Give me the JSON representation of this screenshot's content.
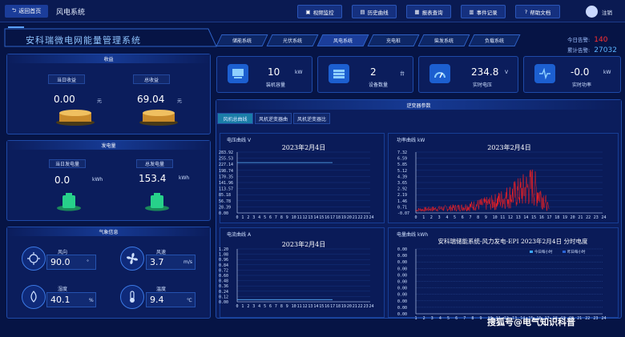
{
  "topbar": {
    "back_label": "返回首页",
    "system_name": "风电系统",
    "buttons": [
      "视频监控",
      "历史曲线",
      "报表查询",
      "事件记录",
      "帮助文档"
    ],
    "user": "注销"
  },
  "header": {
    "app_title": "安科瑞微电网能量管理系统",
    "nav_tabs": [
      "储能系统",
      "光伏系统",
      "风电系统",
      "充电桩",
      "柴发系统",
      "负载系统"
    ],
    "today_alarm_label": "今日告警:",
    "today_alarm_value": "140",
    "total_alarm_label": "累计告警:",
    "total_alarm_value": "27032"
  },
  "income": {
    "title": "收益",
    "today_label": "当日收益",
    "total_label": "总收益",
    "today_value": "0.00",
    "total_value": "69.04",
    "unit": "元"
  },
  "generation": {
    "title": "发电量",
    "today_label": "当日发电量",
    "total_label": "总发电量",
    "today_value": "0.0",
    "total_value": "153.4",
    "unit": "kWh"
  },
  "weather": {
    "title": "气象信息",
    "items": [
      {
        "label": "风向",
        "value": "90.0",
        "unit": "°",
        "icon": "wind-direction-icon"
      },
      {
        "label": "风速",
        "value": "3.7",
        "unit": "m/s",
        "icon": "fan-icon"
      },
      {
        "label": "湿度",
        "value": "40.1",
        "unit": "%",
        "icon": "humidity-icon"
      },
      {
        "label": "温度",
        "value": "9.4",
        "unit": "℃",
        "icon": "thermometer-icon"
      }
    ]
  },
  "stats": [
    {
      "value": "10",
      "unit": "kW",
      "label": "装机容量",
      "icon": "installed-capacity-icon"
    },
    {
      "value": "2",
      "unit": "台",
      "label": "设备数量",
      "icon": "device-count-icon"
    },
    {
      "value": "234.8",
      "unit": "V",
      "label": "实时电压",
      "icon": "voltage-gauge-icon"
    },
    {
      "value": "-0.0",
      "unit": "kW",
      "label": "实时功率",
      "icon": "power-wave-icon"
    }
  ],
  "inverter": {
    "title": "逆变器参数",
    "tabs": [
      "风机总曲线",
      "风机逆变器曲",
      "风机逆变器比"
    ]
  },
  "charts": {
    "voltage": {
      "label": "电压曲线",
      "unit": "V",
      "date": "2023年2月4日"
    },
    "power": {
      "label": "功率曲线",
      "unit": "kW",
      "date": "2023年2月4日"
    },
    "current": {
      "label": "电流曲线",
      "unit": "A",
      "date": "2023年2月4日"
    },
    "energy": {
      "label": "电量曲线",
      "unit": "kWh",
      "heading": "安科瑞储能系统-风力发电-EPI  2023年2月4日  分时电度",
      "legend": [
        "今日每小时",
        "昨日每小时"
      ]
    }
  },
  "chart_data": [
    {
      "type": "line",
      "ylabel": "V",
      "title": "2023年2月4日",
      "yticks": [
        "283.92",
        "255.53",
        "227.14",
        "198.74",
        "170.35",
        "141.96",
        "113.57",
        "85.18",
        "56.78",
        "28.39",
        "0.00"
      ],
      "xticks": [
        "0",
        "1",
        "2",
        "3",
        "4",
        "5",
        "6",
        "7",
        "8",
        "9",
        "10",
        "11",
        "12",
        "13",
        "14",
        "15",
        "16",
        "17",
        "18",
        "19",
        "20",
        "21",
        "22",
        "23",
        "24"
      ],
      "ylim": [
        0,
        283.92
      ],
      "series": [
        {
          "values": [
            {
              "x": 0,
              "y": 235
            },
            {
              "x": 17.2,
              "y": 235
            }
          ]
        }
      ],
      "color": "#5ab4ff"
    },
    {
      "type": "line",
      "ylabel": "kW",
      "title": "2023年2月4日",
      "yticks": [
        "7.32",
        "6.59",
        "5.85",
        "5.12",
        "4.39",
        "3.65",
        "2.92",
        "2.19",
        "1.46",
        "0.71",
        "-0.07"
      ],
      "xticks": [
        "0",
        "1",
        "2",
        "3",
        "4",
        "5",
        "6",
        "7",
        "8",
        "9",
        "10",
        "11",
        "12",
        "13",
        "14",
        "15",
        "16",
        "17",
        "18",
        "19",
        "20",
        "21",
        "22",
        "23",
        "24"
      ],
      "ylim": [
        -0.07,
        7.32
      ],
      "series": [
        {
          "values": [
            {
              "x": 0,
              "y": 0.3
            },
            {
              "x": 6,
              "y": 0.6
            },
            {
              "x": 10,
              "y": 1.2
            },
            {
              "x": 13,
              "y": 2.3
            },
            {
              "x": 15,
              "y": 3.2
            },
            {
              "x": 16.5,
              "y": 1.6
            },
            {
              "x": 17.2,
              "y": 0.2
            }
          ]
        }
      ],
      "color": "#ff2020"
    },
    {
      "type": "line",
      "ylabel": "A",
      "title": "2023年2月4日",
      "yticks": [
        "1.20",
        "1.08",
        "0.96",
        "0.84",
        "0.72",
        "0.60",
        "0.48",
        "0.36",
        "0.24",
        "0.12",
        "0.00"
      ],
      "xticks": [
        "0",
        "1",
        "2",
        "3",
        "4",
        "5",
        "6",
        "7",
        "8",
        "9",
        "10",
        "11",
        "12",
        "13",
        "14",
        "15",
        "16",
        "17",
        "18",
        "19",
        "20",
        "21",
        "22",
        "23",
        "24"
      ],
      "ylim": [
        0,
        1.2
      ],
      "series": [
        {
          "values": [
            {
              "x": 0,
              "y": 0.05
            },
            {
              "x": 17.2,
              "y": 0.05
            }
          ]
        }
      ],
      "color": "#5ab4ff"
    },
    {
      "type": "bar",
      "ylabel": "kWh",
      "title": "安科瑞储能系统-风力发电-EPI  2023年2月4日  分时电度",
      "yticks": [
        "0.00",
        "0.00",
        "0.00",
        "0.00",
        "0.00",
        "0.00",
        "0.00",
        "0.00",
        "0.00",
        "0.00",
        "0.00"
      ],
      "xticks": [
        "1",
        "2",
        "3",
        "4",
        "5",
        "6",
        "7",
        "8",
        "9",
        "10",
        "11",
        "12",
        "13",
        "14",
        "15",
        "16",
        "17",
        "18",
        "19",
        "20",
        "21",
        "22",
        "23",
        "24"
      ],
      "series": [
        {
          "name": "今日每小时",
          "values": [
            0,
            0,
            0,
            0,
            0,
            0,
            0,
            0,
            0,
            0,
            0,
            0,
            0,
            0,
            0,
            0,
            0,
            0,
            0,
            0,
            0,
            0,
            0,
            0
          ]
        },
        {
          "name": "昨日每小时",
          "values": [
            0,
            0,
            0,
            0,
            0,
            0,
            0,
            0,
            0,
            0,
            0,
            0,
            0,
            0,
            0,
            0,
            0,
            0,
            0,
            0,
            0,
            0,
            0,
            0
          ]
        }
      ]
    }
  ],
  "watermark": "搜狐号@电气知识科普"
}
